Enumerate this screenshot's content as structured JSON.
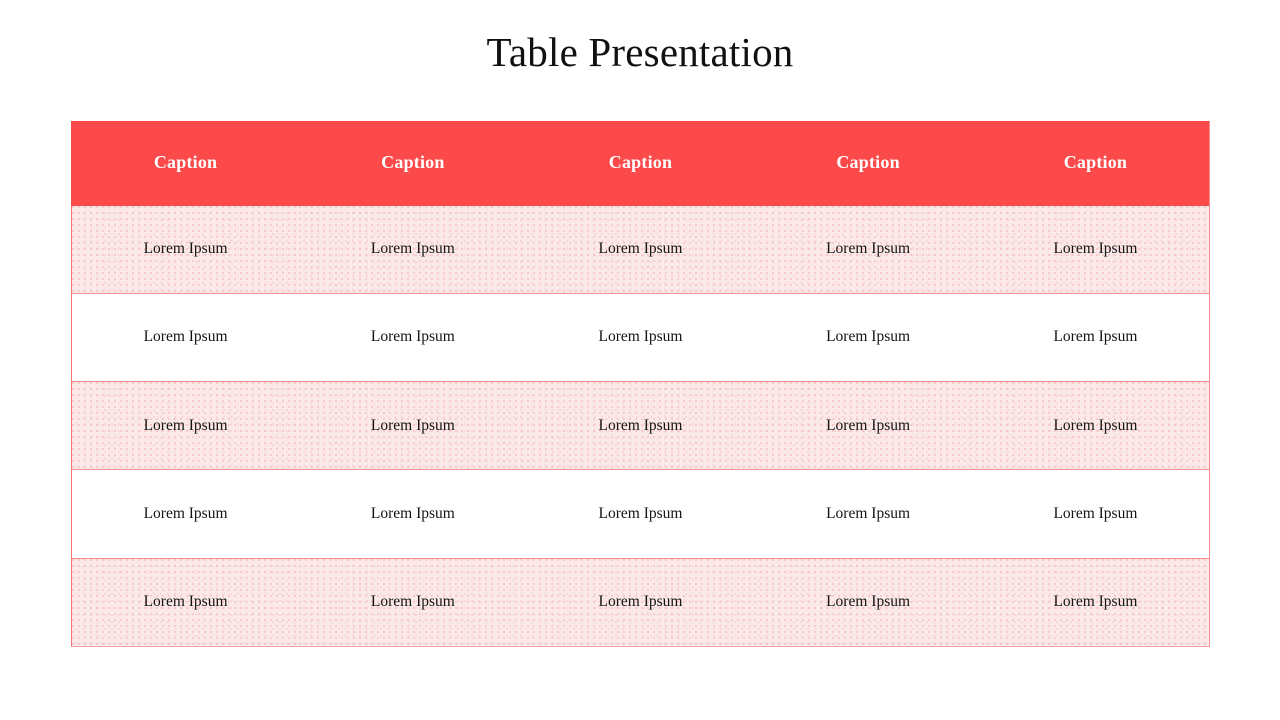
{
  "slide": {
    "title": "Table Presentation",
    "background_color": "#ffffff"
  },
  "theme": {
    "header_background": "#fb4a49",
    "header_text_color": "#ffffff",
    "tinted_row_background": "#fbe8e8",
    "plain_row_background": "#ffffff",
    "row_divider_color": "#ef4f4f",
    "body_text_color": "#141414"
  },
  "table": {
    "columns": 5,
    "header": [
      "Caption",
      "Caption",
      "Caption",
      "Caption",
      "Caption"
    ],
    "rows": [
      {
        "style": "tinted",
        "cells": [
          "Lorem Ipsum",
          "Lorem Ipsum",
          "Lorem Ipsum",
          "Lorem Ipsum",
          "Lorem Ipsum"
        ]
      },
      {
        "style": "plain",
        "cells": [
          "Lorem Ipsum",
          "Lorem Ipsum",
          "Lorem Ipsum",
          "Lorem Ipsum",
          "Lorem Ipsum"
        ]
      },
      {
        "style": "tinted",
        "cells": [
          "Lorem Ipsum",
          "Lorem Ipsum",
          "Lorem Ipsum",
          "Lorem Ipsum",
          "Lorem Ipsum"
        ]
      },
      {
        "style": "plain",
        "cells": [
          "Lorem Ipsum",
          "Lorem Ipsum",
          "Lorem Ipsum",
          "Lorem Ipsum",
          "Lorem Ipsum"
        ]
      },
      {
        "style": "tinted",
        "cells": [
          "Lorem Ipsum",
          "Lorem Ipsum",
          "Lorem Ipsum",
          "Lorem Ipsum",
          "Lorem Ipsum"
        ]
      }
    ]
  }
}
